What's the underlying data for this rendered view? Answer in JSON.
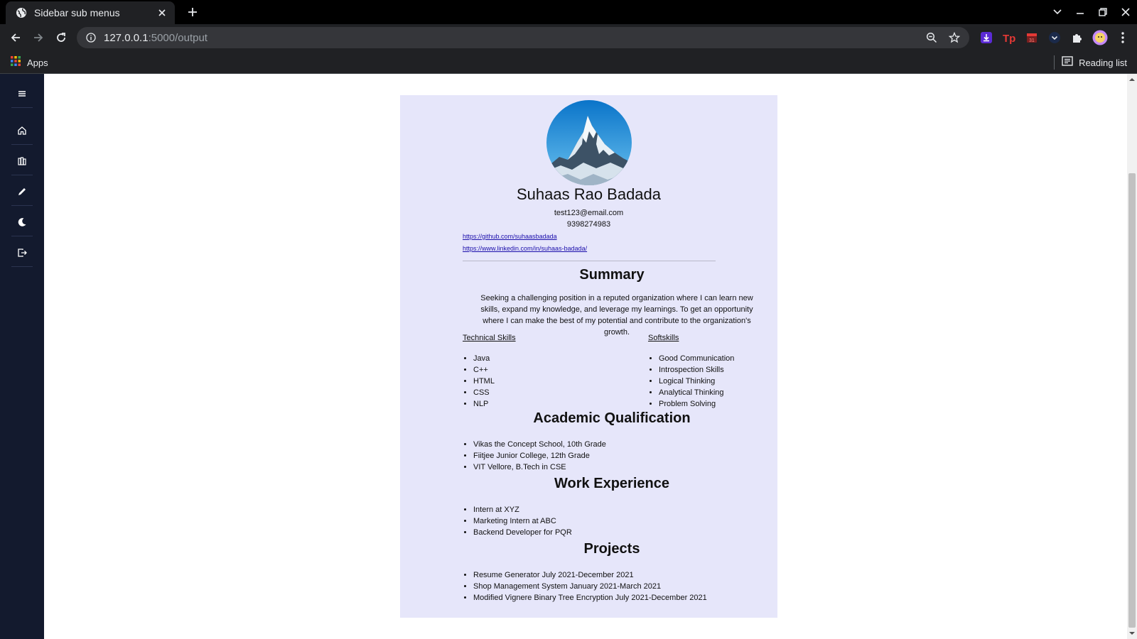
{
  "browser": {
    "tab_title": "Sidebar sub menus",
    "url_host": "127.0.0.1",
    "url_path": ":5000/output",
    "bookmarks_apps": "Apps",
    "reading_list": "Reading list",
    "icons": [
      "globe-icon",
      "close-icon",
      "plus-icon",
      "chevron-down-icon",
      "minimize-icon",
      "restore-icon",
      "back-icon",
      "forward-icon",
      "reload-icon",
      "info-icon",
      "zoom-icon",
      "star-icon",
      "profile-avatar"
    ]
  },
  "sidebar": {
    "items": [
      {
        "name": "menu-icon"
      },
      {
        "name": "home-icon"
      },
      {
        "name": "library-icon"
      },
      {
        "name": "pen-icon"
      },
      {
        "name": "moon-icon"
      },
      {
        "name": "logout-icon"
      }
    ]
  },
  "resume": {
    "name": "Suhaas Rao Badada",
    "email": "test123@email.com",
    "phone": "9398274983",
    "github": "https://github.com/suhaasbadada",
    "linkedin": "https://www.linkedin.com/in/suhaas-badada/",
    "summary_title": "Summary",
    "summary_text": "Seeking a challenging position in a reputed organization where I can learn new skills, expand my knowledge, and leverage my learnings. To get an opportunity where I can make the best of my potential and contribute to the organization's growth.",
    "technical_title": "Technical Skills",
    "technical_skills": [
      "Java",
      "C++",
      "HTML",
      "CSS",
      "NLP"
    ],
    "soft_title": "Softskills",
    "soft_skills": [
      "Good Communication",
      "Introspection Skills",
      "Logical Thinking",
      "Analytical Thinking",
      "Problem Solving"
    ],
    "academic_title": "Academic Qualification",
    "academics": [
      "Vikas the Concept School, 10th Grade",
      "Fiitjee Junior College, 12th Grade",
      "VIT Vellore, B.Tech in CSE"
    ],
    "work_title": "Work Experience",
    "work": [
      "Intern at XYZ",
      "Marketing Intern at ABC",
      "Backend Developer for PQR"
    ],
    "projects_title": "Projects",
    "projects": [
      "Resume Generator July 2021-December 2021",
      "Shop Management System January 2021-March 2021",
      "Modified Vignere Binary Tree Encryption July 2021-December 2021"
    ]
  }
}
